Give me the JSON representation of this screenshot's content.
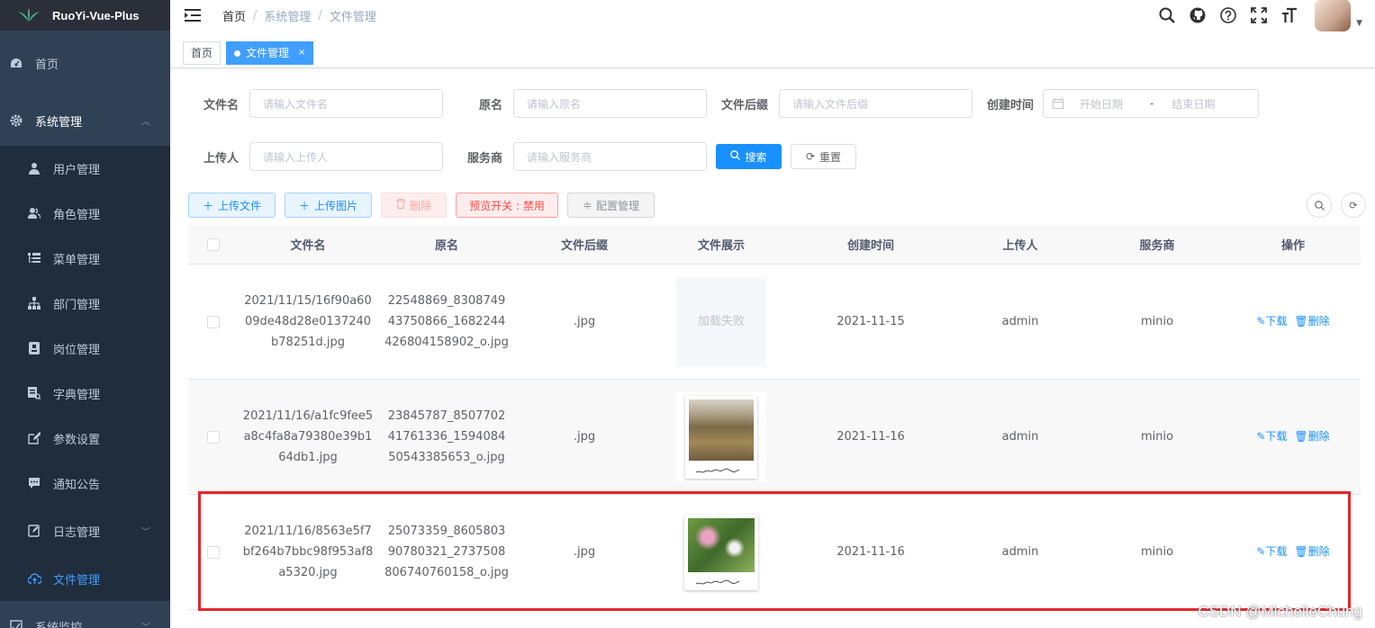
{
  "app": {
    "logo_text": "RuoYi-Vue-Plus"
  },
  "sidebar": {
    "items": [
      {
        "label": "首页",
        "icon": "dashboard-icon"
      },
      {
        "label": "系统管理",
        "icon": "gear-icon"
      },
      {
        "label": "用户管理",
        "icon": "user-icon"
      },
      {
        "label": "角色管理",
        "icon": "peoples-icon"
      },
      {
        "label": "菜单管理",
        "icon": "tree-table-icon"
      },
      {
        "label": "部门管理",
        "icon": "tree-icon"
      },
      {
        "label": "岗位管理",
        "icon": "post-icon"
      },
      {
        "label": "字典管理",
        "icon": "dict-icon"
      },
      {
        "label": "参数设置",
        "icon": "edit-icon"
      },
      {
        "label": "通知公告",
        "icon": "message-icon"
      },
      {
        "label": "日志管理",
        "icon": "log-icon"
      },
      {
        "label": "文件管理",
        "icon": "upload-icon"
      },
      {
        "label": "系统监控",
        "icon": "monitor-icon"
      }
    ]
  },
  "breadcrumb": [
    "首页",
    "系统管理",
    "文件管理"
  ],
  "tags": {
    "home": "首页",
    "active": "文件管理",
    "close": "×"
  },
  "search": {
    "filename_label": "文件名",
    "filename_placeholder": "请输入文件名",
    "origname_label": "原名",
    "origname_placeholder": "请输入原名",
    "suffix_label": "文件后缀",
    "suffix_placeholder": "请输入文件后缀",
    "created_label": "创建时间",
    "date_start": "开始日期",
    "date_sep": "-",
    "date_end": "结束日期",
    "uploader_label": "上传人",
    "uploader_placeholder": "请输入上传人",
    "service_label": "服务商",
    "service_placeholder": "请输入服务商",
    "search_btn": "搜索",
    "reset_btn": "重置"
  },
  "toolbar": {
    "upload_file": "上传文件",
    "upload_image": "上传图片",
    "delete": "删除",
    "preview_toggle": "预览开关 : 禁用",
    "config": "配置管理"
  },
  "table": {
    "headers": [
      "文件名",
      "原名",
      "文件后缀",
      "文件展示",
      "创建时间",
      "上传人",
      "服务商",
      "操作"
    ],
    "download": "下载",
    "remove": "删除",
    "rows": [
      {
        "name_lines": [
          "2021/11/15/16f90a60",
          "09de48d28e0137240",
          "b78251d.jpg"
        ],
        "orig_lines": [
          "22548869_8308749",
          "43750866_1682244",
          "426804158902_o.jpg"
        ],
        "suffix": ".jpg",
        "image_fail": "加载失败",
        "created": "2021-11-15",
        "uploader": "admin",
        "service": "minio"
      },
      {
        "name_lines": [
          "2021/11/16/a1fc9fee5",
          "a8c4fa8a79380e39b1",
          "64db1.jpg"
        ],
        "orig_lines": [
          "23845787_8507702",
          "41761336_1594084",
          "50543385653_o.jpg"
        ],
        "suffix": ".jpg",
        "image_fail": "",
        "created": "2021-11-16",
        "uploader": "admin",
        "service": "minio"
      },
      {
        "name_lines": [
          "2021/11/16/8563e5f7",
          "bf264b7bbc98f953af8",
          "a5320.jpg"
        ],
        "orig_lines": [
          "25073359_8605803",
          "90780321_2737508",
          "806740760158_o.jpg"
        ],
        "suffix": ".jpg",
        "image_fail": "",
        "created": "2021-11-16",
        "uploader": "admin",
        "service": "minio"
      }
    ]
  },
  "watermark": "CSDN @MichelleChung",
  "colors": {
    "sidebar_bg": "#304156",
    "primary": "#1890ff",
    "active_menu": "#409eff",
    "highlight": "#e3262b"
  }
}
